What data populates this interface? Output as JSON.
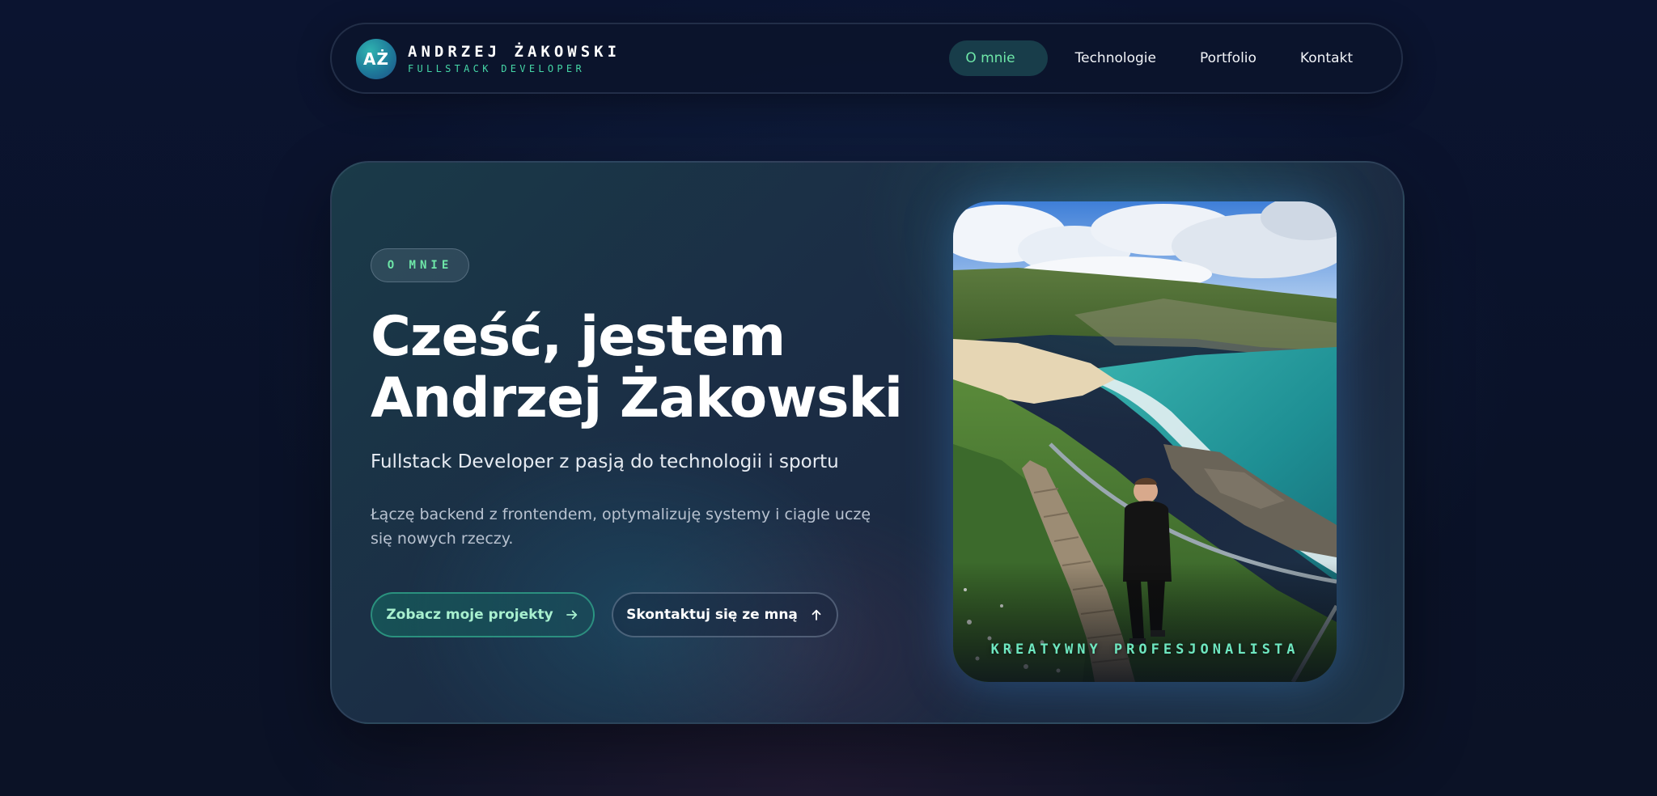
{
  "brand": {
    "monogram": "AŻ",
    "name": "ANDRZEJ ŻAKOWSKI",
    "role": "FULLSTACK DEVELOPER"
  },
  "nav": {
    "items": [
      {
        "label": "O mnie",
        "active": true
      },
      {
        "label": "Technologie",
        "active": false
      },
      {
        "label": "Portfolio",
        "active": false
      },
      {
        "label": "Kontakt",
        "active": false
      }
    ]
  },
  "hero": {
    "badge": "O MNIE",
    "headline_line1": "Cześć, jestem",
    "headline_line2": "Andrzej Żakowski",
    "subtitle": "Fullstack Developer z pasją do technologii i sportu",
    "description": "Łączę backend z frontendem, optymalizuję systemy i ciągle uczę się nowych rzeczy.",
    "primary_button": {
      "label": "Zobacz moje projekty",
      "icon": "arrow-right-icon"
    },
    "secondary_button": {
      "label": "Skontaktuj się ze mną",
      "icon": "arrow-up-icon"
    },
    "photo_caption": "KREATYWNY PROFESJONALISTA"
  },
  "colors": {
    "accent_green": "#6ee7a8",
    "background": "#0b1430",
    "card": "#1b2d45"
  }
}
